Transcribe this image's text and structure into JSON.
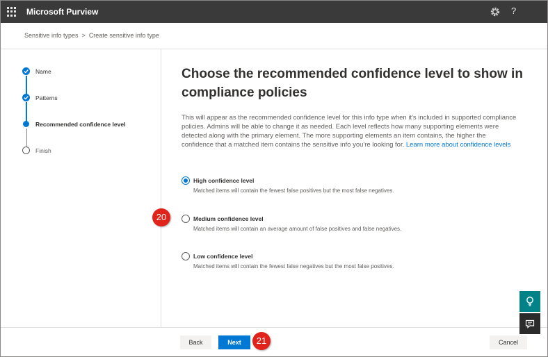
{
  "header": {
    "app_title": "Microsoft Purview",
    "help_label": "?"
  },
  "breadcrumb": {
    "items": [
      "Sensitive info types",
      "Create sensitive info type"
    ],
    "separator": ">"
  },
  "steps": [
    {
      "label": "Name",
      "state": "done"
    },
    {
      "label": "Patterns",
      "state": "done"
    },
    {
      "label": "Recommended confidence level",
      "state": "current"
    },
    {
      "label": "Finish",
      "state": "todo"
    }
  ],
  "main": {
    "heading": "Choose the recommended confidence level to show in compliance policies",
    "description": "This will appear as the recommended confidence level for this info type when it's included in supported compliance policies. Admins will be able to change it as needed. Each level reflects how many supporting elements were detected along with the primary element. The more supporting elements an item contains, the higher the confidence that a matched item contains the sensitive info you're looking for.",
    "learn_more": "Learn more about confidence levels",
    "options": [
      {
        "title": "High confidence level",
        "desc": "Matched items will contain the fewest false positives but the most false negatives.",
        "selected": true
      },
      {
        "title": "Medium confidence level",
        "desc": "Matched items will contain an average amount of false positives and false negatives.",
        "selected": false
      },
      {
        "title": "Low confidence level",
        "desc": "Matched items will contain the fewest false negatives but the most false positives.",
        "selected": false
      }
    ]
  },
  "annotations": {
    "badge_medium": "20",
    "badge_next": "21"
  },
  "footer": {
    "back_label": "Back",
    "next_label": "Next",
    "cancel_label": "Cancel"
  },
  "colors": {
    "accent": "#0078d4",
    "topbar": "#3a3a3a",
    "badge": "#e0231b",
    "teal": "#038387"
  },
  "icons": {
    "waffle": "app-launcher-icon",
    "settings": "settings-icon",
    "help": "help-icon",
    "step_done": "checkmark-icon",
    "side_teal": "lightbulb-icon",
    "side_dark": "feedback-icon"
  }
}
